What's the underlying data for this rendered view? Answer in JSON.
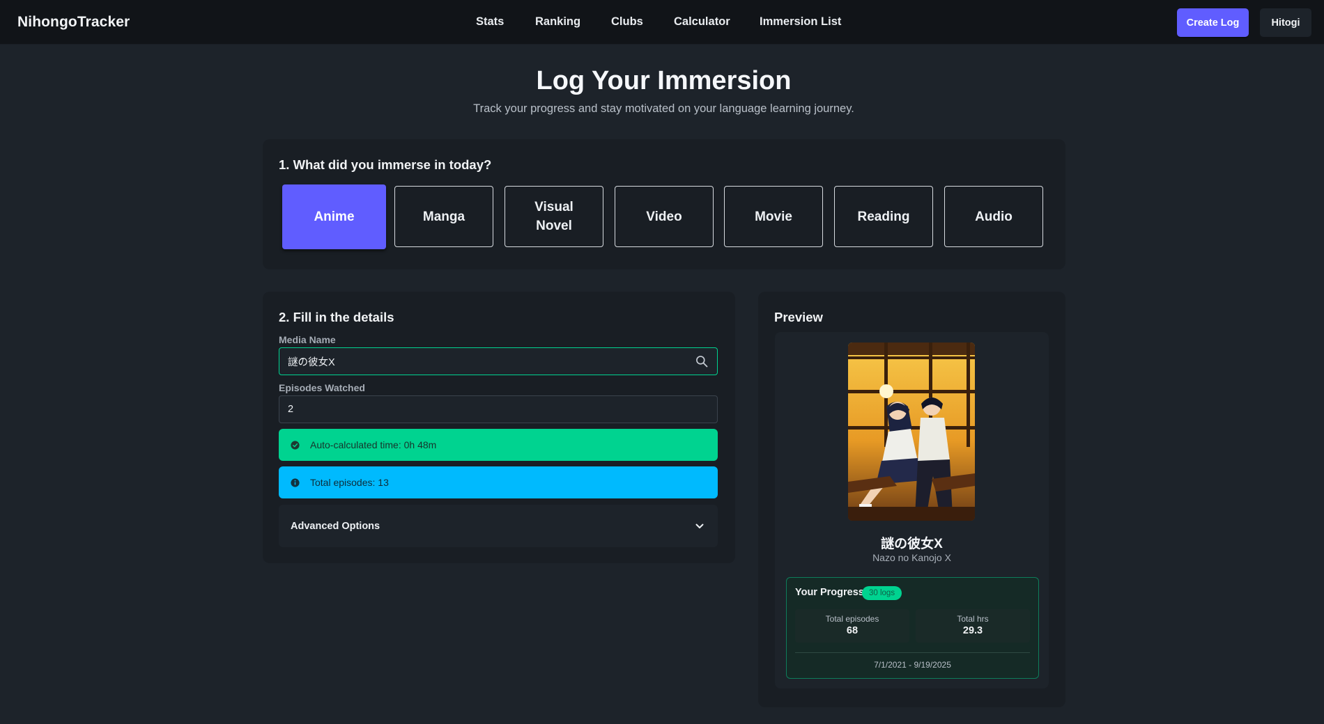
{
  "navbar": {
    "brand": "NihongoTracker",
    "links": [
      "Stats",
      "Ranking",
      "Clubs",
      "Calculator",
      "Immersion List"
    ],
    "create_label": "Create Log",
    "user_label": "Hitogi"
  },
  "header": {
    "title": "Log Your Immersion",
    "subtitle": "Track your progress and stay motivated on your language learning journey."
  },
  "step1": {
    "title": "1. What did you immerse in today?",
    "types": [
      "Anime",
      "Manga",
      "Visual Novel",
      "Video",
      "Movie",
      "Reading",
      "Audio"
    ],
    "selected": "Anime"
  },
  "step2": {
    "title": "2. Fill in the details",
    "media_label": "Media Name",
    "media_value": "謎の彼女X",
    "episodes_label": "Episodes Watched",
    "episodes_value": "2",
    "auto_time": "Auto-calculated time: 0h 48m",
    "total_episodes": "Total episodes: 13",
    "advanced": "Advanced Options"
  },
  "preview": {
    "title": "Preview",
    "media_title": "謎の彼女X",
    "media_romaji": "Nazo no Kanojo X",
    "progress_title": "Your Progress",
    "logs_badge": "30 logs",
    "stat1_label": "Total episodes",
    "stat1_value": "68",
    "stat2_label": "Total hrs",
    "stat2_value": "29.3",
    "date_range": "7/1/2021 - 9/19/2025"
  },
  "colors": {
    "primary": "#605dff",
    "success": "#00d390",
    "info": "#00bafe",
    "background": "#1d232a",
    "card": "#191e24"
  },
  "icons": [
    "search-icon",
    "check-circle-icon",
    "info-icon",
    "chevron-down-icon"
  ]
}
